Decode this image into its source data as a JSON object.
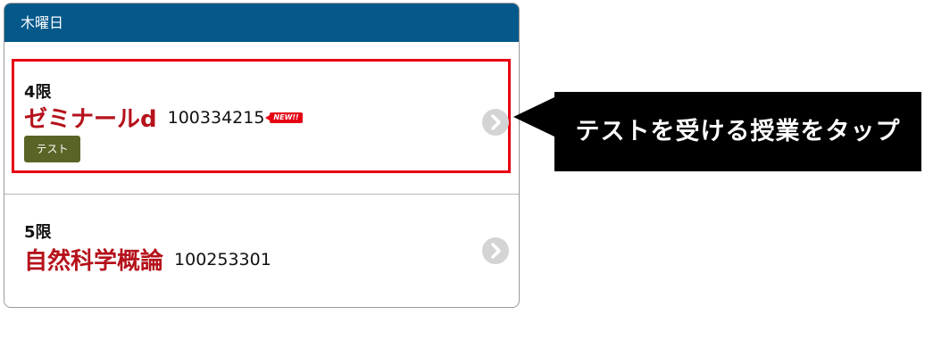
{
  "header": {
    "day_label": "木曜日"
  },
  "classes": [
    {
      "period": "4限",
      "name": "ゼミナールd",
      "code": "100334215",
      "new_badge": "NEW!!",
      "tag_label": "テスト",
      "highlighted": true
    },
    {
      "period": "5限",
      "name": "自然科学概論",
      "code": "100253301",
      "highlighted": false
    }
  ],
  "callout": {
    "text": "テストを受ける授業をタップ"
  },
  "icons": {
    "row_arrow": "chevron-right-circle-icon"
  },
  "colors": {
    "header_bg": "#04598a",
    "course_name": "#b5121b",
    "highlight_border": "#e60012",
    "test_tag_bg": "#5a6426",
    "callout_bg": "#000000"
  }
}
